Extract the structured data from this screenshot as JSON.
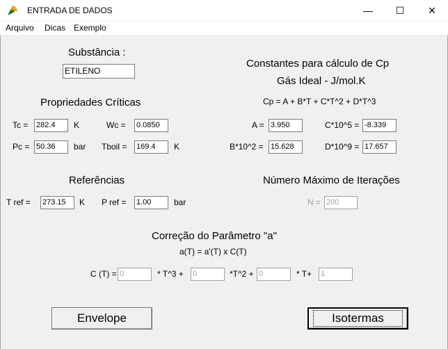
{
  "window": {
    "title": "ENTRADA DE DADOS",
    "minimize": "—",
    "maximize": "☐",
    "close": "✕"
  },
  "menu": [
    "Arquivo",
    "Dicas",
    "Exemplo"
  ],
  "substance": {
    "label": "Substância :",
    "value": "ETILENO"
  },
  "critical": {
    "title": "Propriedades Críticas",
    "tc_label": "Tc =",
    "tc_value": "282.4",
    "tc_unit": "K",
    "wc_label": "Wc =",
    "wc_value": "0.0850",
    "pc_label": "Pc =",
    "pc_value": "50.36",
    "pc_unit": "bar",
    "tboil_label": "Tboil =",
    "tboil_value": "169.4",
    "tboil_unit": "K"
  },
  "cp": {
    "title1": "Constantes para cálculo de Cp",
    "title2": "Gás Ideal - J/mol.K",
    "formula": "Cp = A + B*T + C*T^2 + D*T^3",
    "a_label": "A =",
    "a_value": "3.950",
    "c_label": "C*10^5 =",
    "c_value": "-8.339",
    "b_label": "B*10^2 =",
    "b_value": "15.628",
    "d_label": "D*10^9 =",
    "d_value": "17.657"
  },
  "refs": {
    "title": "Referências",
    "tref_label": "T ref =",
    "tref_value": "273.15",
    "tref_unit": "K",
    "pref_label": "P ref =",
    "pref_value": "1.00",
    "pref_unit": "bar"
  },
  "iter": {
    "title": "Número Máximo de Iterações",
    "n_label": "N =",
    "n_value": "200"
  },
  "correction": {
    "title": "Correção do Parâmetro \"a\"",
    "formula": "a(T) = a'(T) x C(T)",
    "ct_label": "C (T) =",
    "c3_value": "0",
    "t3_label": "* T^3 +",
    "c2_value": "0",
    "t2_label": "*T^2 +",
    "c1_value": "0",
    "t1_label": "* T+",
    "c0_value": "1"
  },
  "buttons": {
    "envelope": "Envelope",
    "isotermas": "Isotermas"
  }
}
